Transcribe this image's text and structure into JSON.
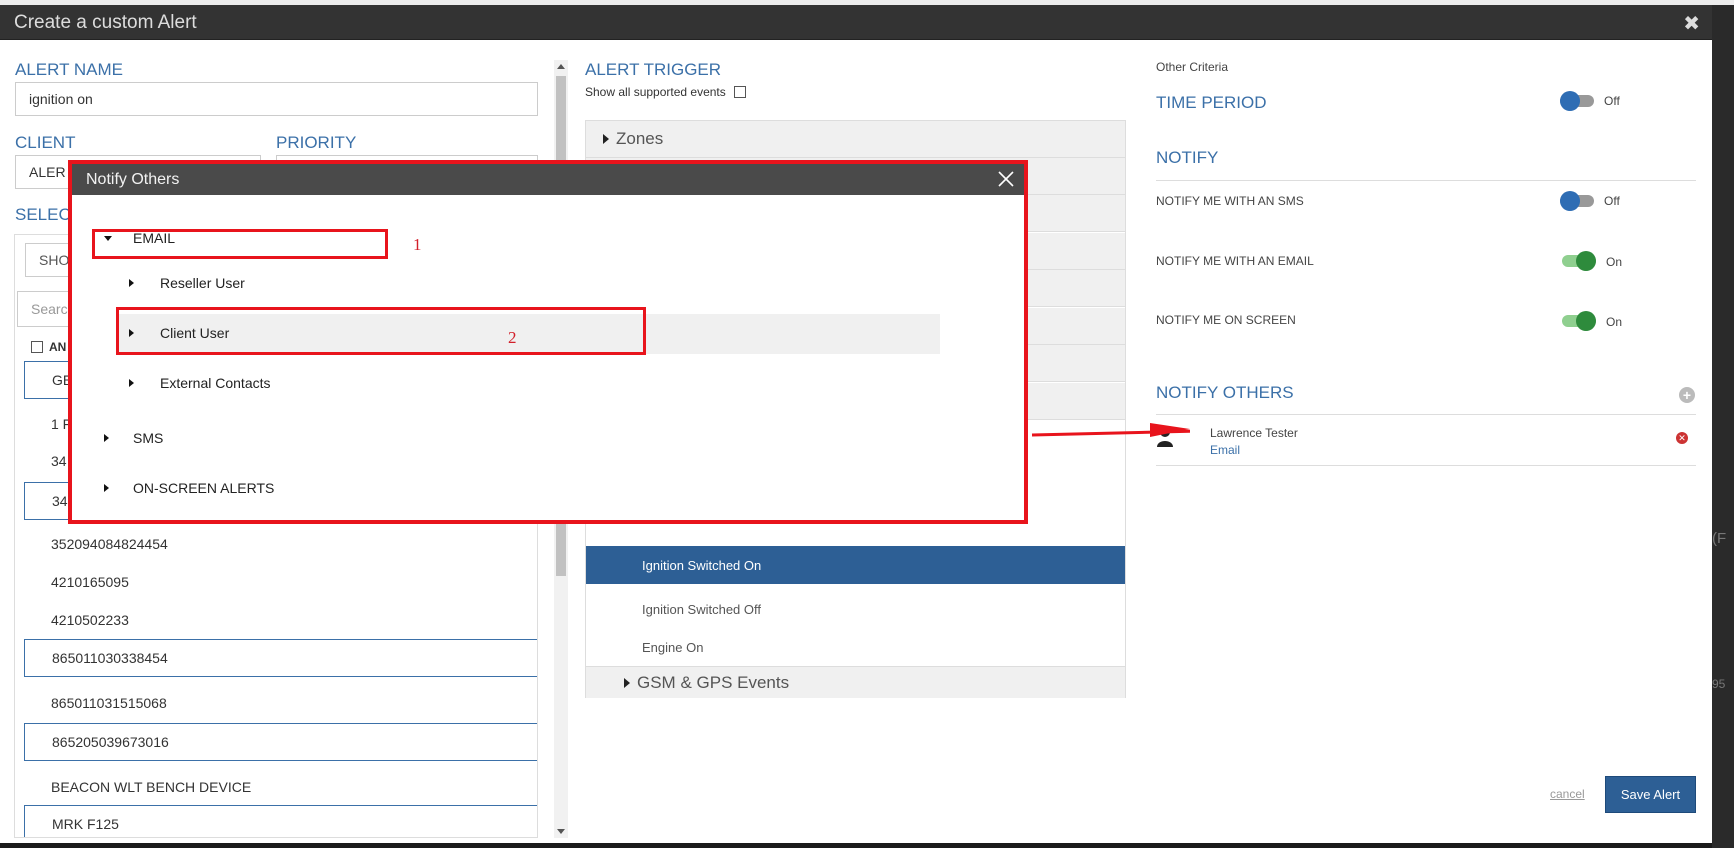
{
  "modal": {
    "title": "Create a custom Alert",
    "close_glyph": "✖"
  },
  "left": {
    "alert_name_label": "ALERT NAME",
    "alert_name_value": "ignition on",
    "client_label": "CLIENT",
    "client_value": "ALER",
    "priority_label": "PRIORITY",
    "select_label": "SELEC",
    "show_button": "SHO",
    "search_placeholder": "Searc",
    "all_label": "AN",
    "devices": [
      {
        "label": "GE",
        "boxed": true
      },
      {
        "label": "1 F",
        "boxed": false
      },
      {
        "label": "34",
        "boxed": false
      },
      {
        "label": "34",
        "boxed": true
      },
      {
        "label": "352094084824454",
        "boxed": false
      },
      {
        "label": "4210165095",
        "boxed": false
      },
      {
        "label": "4210502233",
        "boxed": false
      },
      {
        "label": "865011030338454",
        "boxed": true
      },
      {
        "label": "865011031515068",
        "boxed": false
      },
      {
        "label": "865205039673016",
        "boxed": true
      },
      {
        "label": "BEACON WLT BENCH DEVICE",
        "boxed": false
      },
      {
        "label": "MRK F125",
        "boxed": true
      }
    ]
  },
  "trigger": {
    "title": "ALERT TRIGGER",
    "show_all": "Show all supported events",
    "zones": "Zones",
    "events": [
      {
        "label": "Ignition Switched On",
        "selected": true
      },
      {
        "label": "Ignition Switched Off",
        "selected": false
      },
      {
        "label": "Engine On",
        "selected": false
      }
    ],
    "gsm_gps": "GSM & GPS Events"
  },
  "right": {
    "other_criteria": "Other Criteria",
    "time_period": "TIME PERIOD",
    "time_period_state": "Off",
    "notify": "NOTIFY",
    "sms_label": "NOTIFY ME WITH AN SMS",
    "sms_state": "Off",
    "email_label": "NOTIFY ME WITH AN EMAIL",
    "email_state": "On",
    "screen_label": "NOTIFY ME ON SCREEN",
    "screen_state": "On",
    "notify_others": "NOTIFY OTHERS",
    "contact_name": "Lawrence Tester",
    "contact_method": "Email",
    "cancel": "cancel",
    "save": "Save Alert"
  },
  "dialog": {
    "title": "Notify Others",
    "email": "EMAIL",
    "reseller_user": "Reseller User",
    "client_user": "Client User",
    "external_contacts": "External Contacts",
    "sms": "SMS",
    "on_screen": "ON-SCREEN ALERTS",
    "annotation_1": "1",
    "annotation_2": "2"
  },
  "background": {
    "edge_text_1": "(F",
    "edge_text_2": "95"
  },
  "colors": {
    "accent_blue": "#3b70a8",
    "selected_blue": "#2d5f95",
    "annotation_red": "#e8141c",
    "toggle_on_green": "#2e8b3c"
  }
}
